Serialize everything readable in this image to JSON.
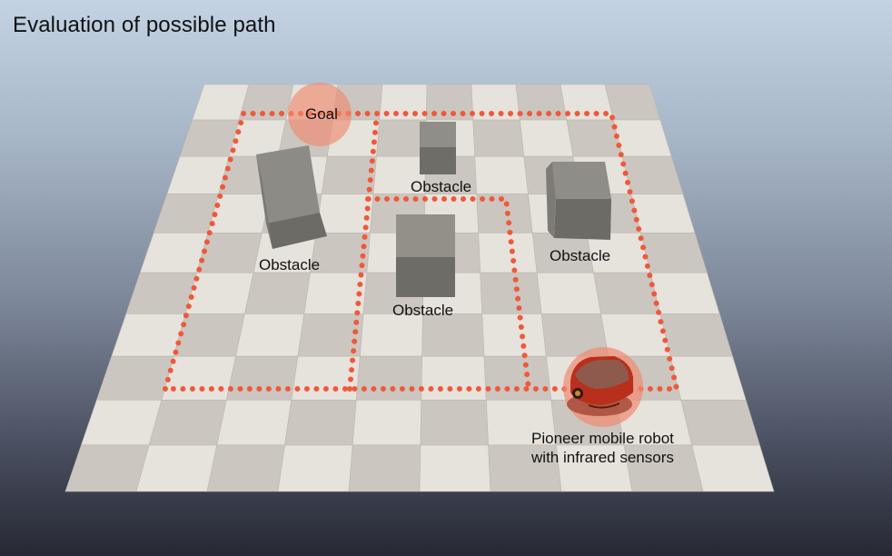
{
  "title": "Evaluation of possible path",
  "labels": {
    "goal": "Goal",
    "obstacle_1": "Obstacle",
    "obstacle_2": "Obstacle",
    "obstacle_3": "Obstacle",
    "obstacle_4": "Obstacle",
    "robot_line1": "Pioneer mobile robot",
    "robot_line2": "with infrared sensors"
  },
  "colors": {
    "path": "#f0583a",
    "goal_marker": "#f08a70",
    "robot": "#c8321e",
    "obstacle": "#8a8882",
    "floor_light": "#e6e2dc",
    "floor_dark": "#cbc6bf"
  }
}
